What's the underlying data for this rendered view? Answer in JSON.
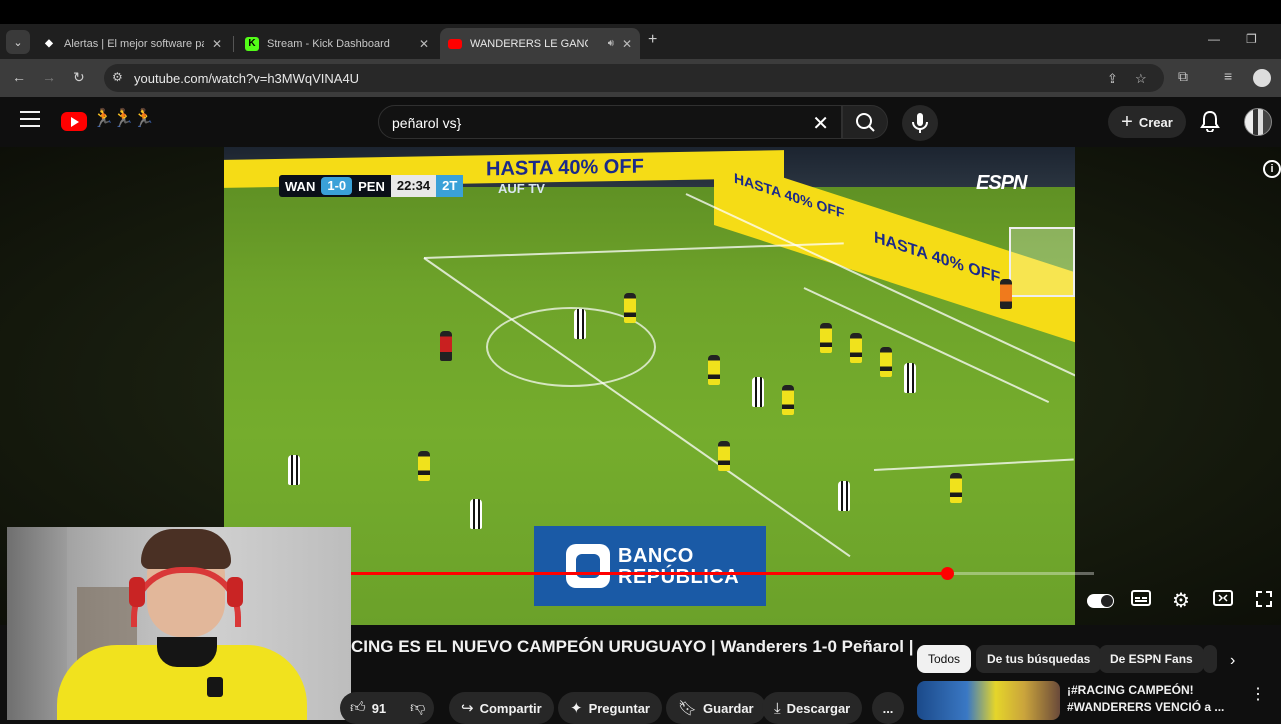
{
  "browser": {
    "tabs": [
      {
        "label": "Alertas | El mejor software para",
        "favicon": "diamond-icon"
      },
      {
        "label": "Stream - Kick Dashboard",
        "favicon": "kick-icon"
      },
      {
        "label": "WANDERERS LE GANÓ A PE",
        "favicon": "youtube-icon"
      }
    ],
    "new_tab": "+",
    "url": "youtube.com/watch?v=h3MWqVINA4U"
  },
  "masthead": {
    "search_query": "peñarol vs}",
    "create_label": "Crear"
  },
  "video": {
    "scorebug": {
      "home": "WAN",
      "score": "1-0",
      "away": "PEN",
      "clock": "22:34",
      "half": "2T"
    },
    "broadcaster": "AUF TV",
    "network": "ESPN",
    "ad_text": "HASTA 40% OFF",
    "sponsor_line1": "BANCO",
    "sponsor_line2": "REPÚBLICA",
    "progress_fraction": 0.802
  },
  "title": "CING ES EL NUEVO CAMPEÓN URUGUAYO | Wanderers 1-0 Peñarol |",
  "actions": {
    "likes": "91",
    "share": "Compartir",
    "ask": "Preguntar",
    "save": "Guardar",
    "download": "Descargar",
    "more": "..."
  },
  "chips": [
    "Todos",
    "De tus búsquedas",
    "De ESPN Fans"
  ],
  "recommendation": {
    "line1": "¡#RACING CAMPEÓN!",
    "line2": "#WANDERERS VENCIÓ a ..."
  },
  "colors": {
    "accent": "#ff0000",
    "chrome_bg": "#3c3c3c",
    "yt_bg": "#0f0f0f",
    "pitch": "#6ea32a"
  }
}
